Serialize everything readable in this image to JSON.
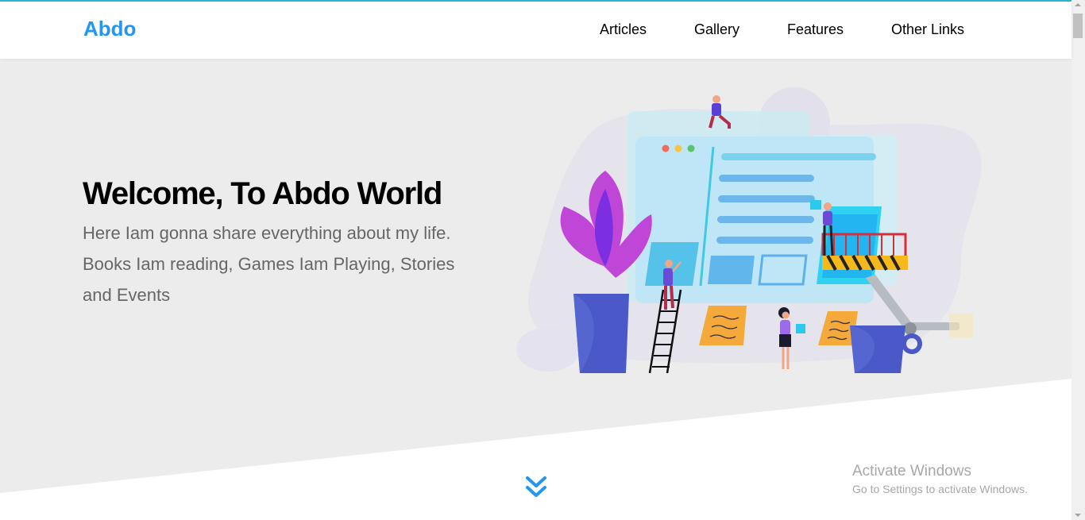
{
  "header": {
    "logo": "Abdo",
    "nav": [
      {
        "label": "Articles"
      },
      {
        "label": "Gallery"
      },
      {
        "label": "Features"
      },
      {
        "label": "Other Links"
      }
    ]
  },
  "landing": {
    "title": "Welcome, To Abdo World",
    "description": "Here Iam gonna share everything about my life. Books Iam reading, Games Iam Playing, Stories and Events",
    "illustration": "website-construction-illustration",
    "go_down_icon": "double-chevron-down-icon"
  },
  "watermark": {
    "title": "Activate Windows",
    "subtitle": "Go to Settings to activate Windows."
  },
  "colors": {
    "accent": "#2196f3",
    "landing_bg": "#ececec",
    "text_dark": "#000000",
    "text_muted": "#666666",
    "top_line": "#2ab7ca"
  }
}
